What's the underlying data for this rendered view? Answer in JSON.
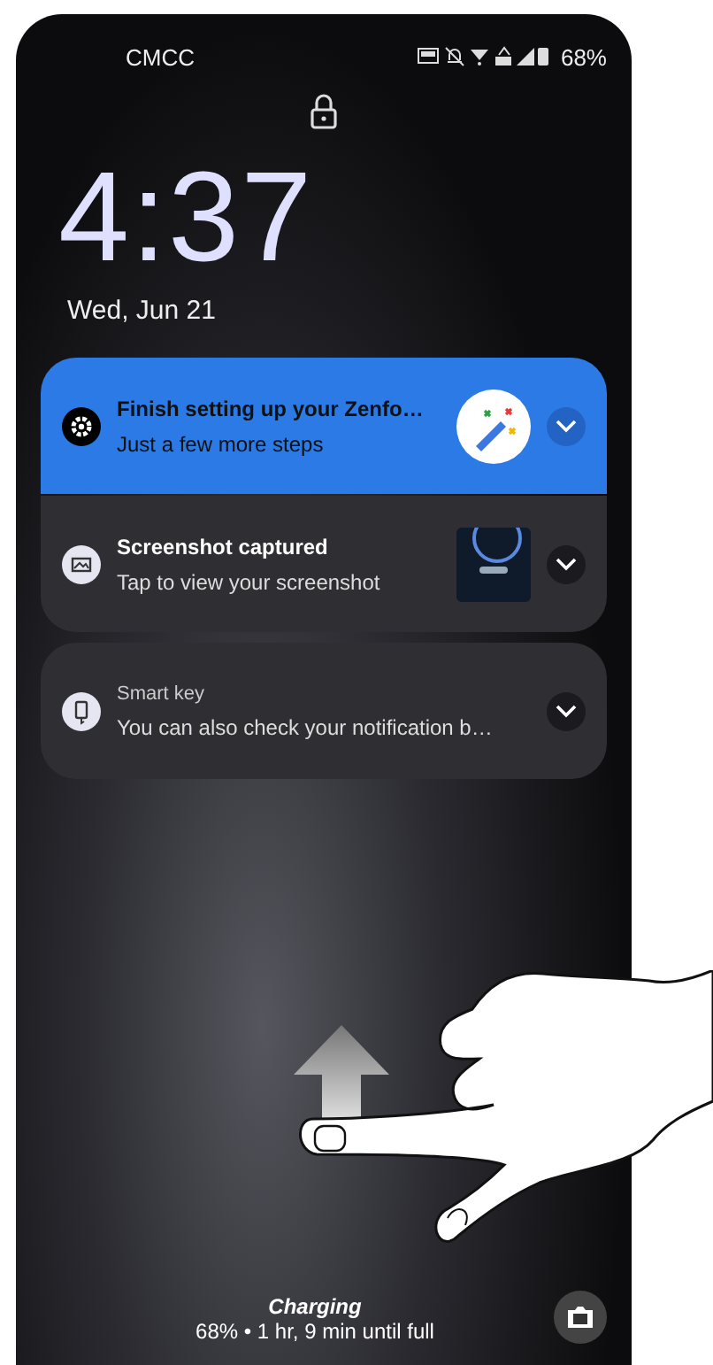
{
  "status_bar": {
    "carrier": "CMCC",
    "battery": "68%"
  },
  "clock": {
    "time": "4:37",
    "date": "Wed, Jun 21"
  },
  "notification_groups": [
    [
      {
        "kind": "setup",
        "title": "Finish setting up your Zenfo…",
        "text": "Just a few more steps"
      },
      {
        "kind": "screenshot",
        "title": "Screenshot captured",
        "text": "Tap to view your screenshot"
      }
    ],
    [
      {
        "kind": "app",
        "app": "Smart key",
        "text": "You can also check your notification b…"
      }
    ]
  ],
  "charging": {
    "title": "Charging",
    "detail": "68% • 1 hr, 9 min until full"
  }
}
